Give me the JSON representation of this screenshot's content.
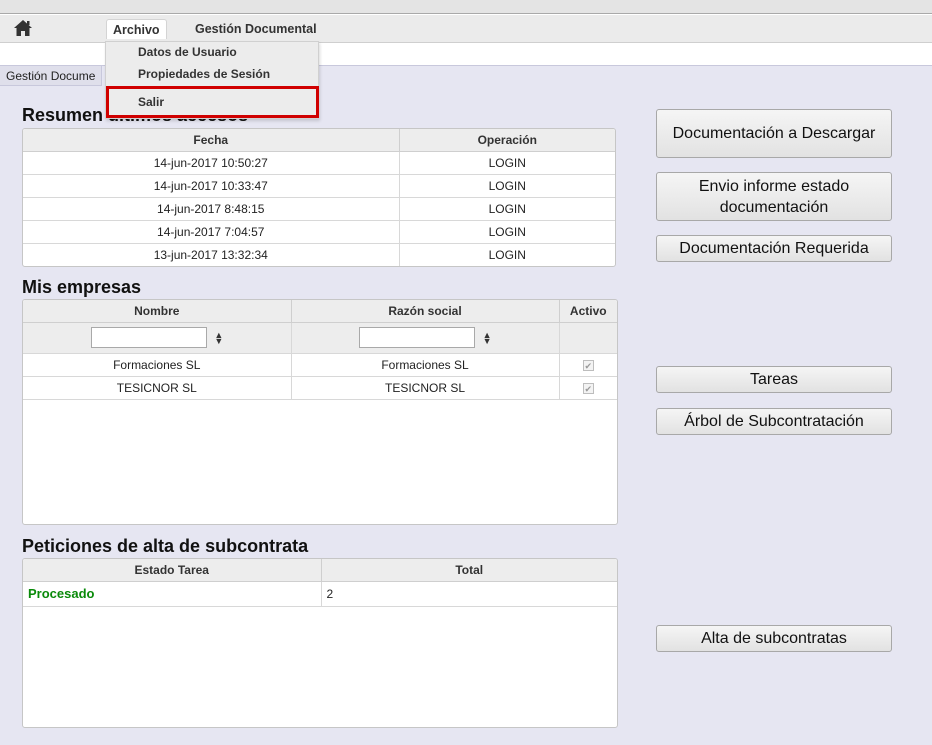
{
  "menubar": {
    "home_icon": "home-icon",
    "items": [
      {
        "label": "Archivo"
      },
      {
        "label": "Gestión Documental"
      }
    ]
  },
  "dropdown": {
    "items": [
      {
        "label": "Datos de Usuario"
      },
      {
        "label": "Propiedades de Sesión"
      },
      {
        "label": "Salir"
      }
    ]
  },
  "content_tab": {
    "label": "Gestión Docume"
  },
  "accesos": {
    "title": "Resumen últimos accesos",
    "columns": [
      "Fecha",
      "Operación"
    ],
    "rows": [
      [
        "14-jun-2017 10:50:27",
        "LOGIN"
      ],
      [
        "14-jun-2017 10:33:47",
        "LOGIN"
      ],
      [
        "14-jun-2017 8:48:15",
        "LOGIN"
      ],
      [
        "14-jun-2017 7:04:57",
        "LOGIN"
      ],
      [
        "13-jun-2017 13:32:34",
        "LOGIN"
      ]
    ]
  },
  "empresas": {
    "title": "Mis empresas",
    "columns": [
      "Nombre",
      "Razón social",
      "Activo"
    ],
    "filters": {
      "nombre": "",
      "razon_social": ""
    },
    "rows": [
      [
        "Formaciones SL",
        "Formaciones SL",
        "✔"
      ],
      [
        "TESICNOR SL",
        "TESICNOR SL",
        "✔"
      ]
    ]
  },
  "peticiones": {
    "title": "Peticiones de alta de subcontrata",
    "columns": [
      "Estado Tarea",
      "Total"
    ],
    "rows": [
      [
        "Procesado",
        "2"
      ]
    ]
  },
  "buttons": {
    "documentacion_descargar": "Documentación a Descargar",
    "envio_informe": "Envio informe estado documentación",
    "documentacion_requerida": "Documentación Requerida",
    "tareas": "Tareas",
    "arbol": "Árbol de Subcontratación",
    "alta_subcontratas": "Alta de subcontratas"
  },
  "colors": {
    "status_green": "#0a8a0a",
    "highlight": "#d00000"
  }
}
